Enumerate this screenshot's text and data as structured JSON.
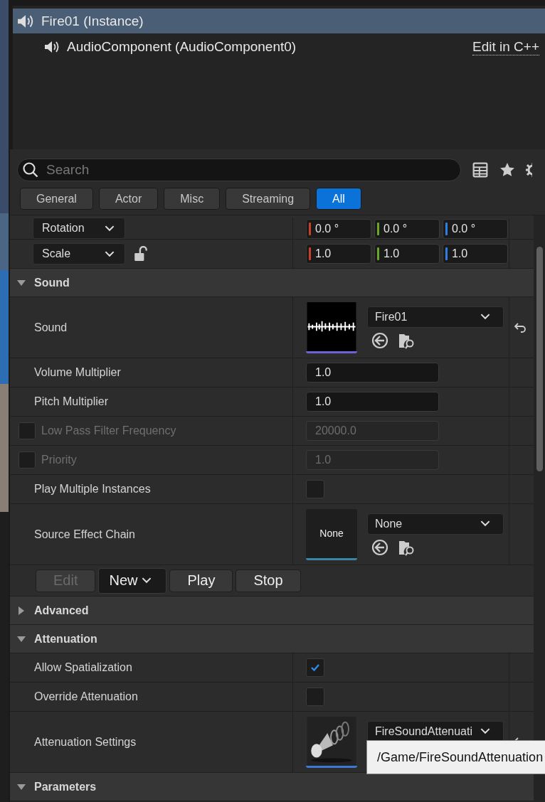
{
  "outliner": {
    "items": [
      {
        "label": "Fire01 (Instance)",
        "selected": true,
        "children": [
          {
            "label": "AudioComponent (AudioComponent0)",
            "selected": false
          }
        ]
      }
    ],
    "edit_link": "Edit in C++"
  },
  "details": {
    "search": {
      "placeholder": "Search"
    },
    "tabs": [
      {
        "label": "General",
        "selected": false
      },
      {
        "label": "Actor",
        "selected": false
      },
      {
        "label": "Misc",
        "selected": false
      },
      {
        "label": "Streaming",
        "selected": false
      },
      {
        "label": "All",
        "selected": true
      }
    ],
    "rows": [
      {
        "kind": "vector",
        "label": "Rotation",
        "locked": null,
        "values": [
          "0.0 °",
          "0.0 °",
          "0.0 °"
        ]
      },
      {
        "kind": "vector",
        "label": "Scale",
        "locked": false,
        "values": [
          "1.0",
          "1.0",
          "1.0"
        ]
      },
      {
        "kind": "section",
        "label": "Sound",
        "expanded": true
      },
      {
        "kind": "asset",
        "label": "Sound",
        "thumbnail": {
          "kind": "waveform"
        },
        "value": "Fire01",
        "browse_tools": true,
        "reset": true
      },
      {
        "kind": "number",
        "label": "Volume Multiplier",
        "value": "1.0",
        "disabled": false
      },
      {
        "kind": "number",
        "label": "Pitch Multiplier",
        "value": "1.0",
        "disabled": false
      },
      {
        "kind": "number",
        "label": "Low Pass Filter Frequency",
        "value": "20000.0",
        "disabled": true,
        "condition": {
          "checked": false
        }
      },
      {
        "kind": "number",
        "label": "Priority",
        "value": "1.0",
        "disabled": true,
        "condition": {
          "checked": false
        }
      },
      {
        "kind": "checkbox",
        "label": "Play Multiple Instances",
        "checked": false
      },
      {
        "kind": "asset",
        "label": "Source Effect Chain",
        "thumbnail": {
          "kind": "text",
          "text": "None"
        },
        "value": "None",
        "browse_tools": true,
        "reset": false
      },
      {
        "kind": "buttons",
        "buttons": [
          {
            "label": "Edit",
            "disabled": true,
            "dropdown": false
          },
          {
            "label": "New",
            "disabled": false,
            "dropdown": true
          },
          {
            "label": "Play",
            "disabled": false,
            "dropdown": false
          },
          {
            "label": "Stop",
            "disabled": false,
            "dropdown": false
          }
        ]
      },
      {
        "kind": "section",
        "label": "Advanced",
        "expanded": false
      },
      {
        "kind": "section",
        "label": "Attenuation",
        "expanded": true
      },
      {
        "kind": "checkbox",
        "label": "Allow Spatialization",
        "checked": true
      },
      {
        "kind": "checkbox",
        "label": "Override Attenuation",
        "checked": false
      },
      {
        "kind": "asset",
        "label": "Attenuation Settings",
        "thumbnail": {
          "kind": "attenuation"
        },
        "value": "FireSoundAttenuati",
        "browse_tools": false,
        "reset": true
      },
      {
        "kind": "section",
        "label": "Parameters",
        "expanded": true
      }
    ]
  },
  "tooltip": "/Game/FireSoundAttenuation"
}
